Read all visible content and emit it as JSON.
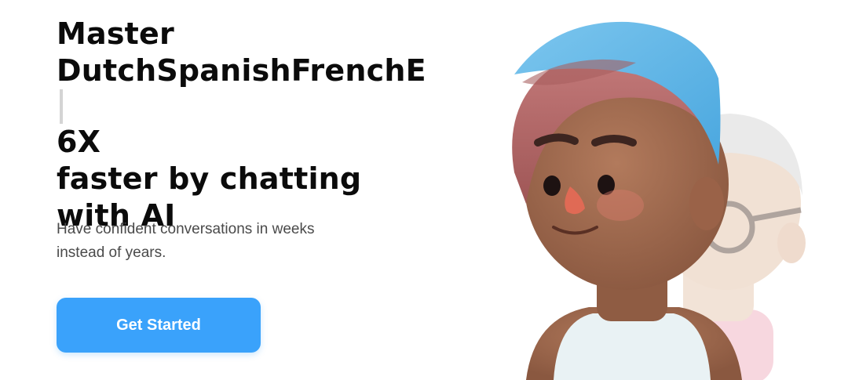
{
  "hero": {
    "headline_line1": "Master",
    "headline_line2": "DutchSpanishFrenchE",
    "headline_line3": "6X",
    "headline_line4": "faster by chatting",
    "headline_line5": "with AI",
    "subtitle_line1": "Have confident conversations in weeks",
    "subtitle_line2": "instead of years.",
    "cta_label": "Get Started"
  },
  "illustration": {
    "front_character": "avatar-boy-blue-cap",
    "back_character": "avatar-elder-glasses"
  },
  "colors": {
    "accent": "#3aa2fb",
    "headline": "#0b0b0b",
    "body_text": "#4a4a4a",
    "background": "#ffffff"
  }
}
